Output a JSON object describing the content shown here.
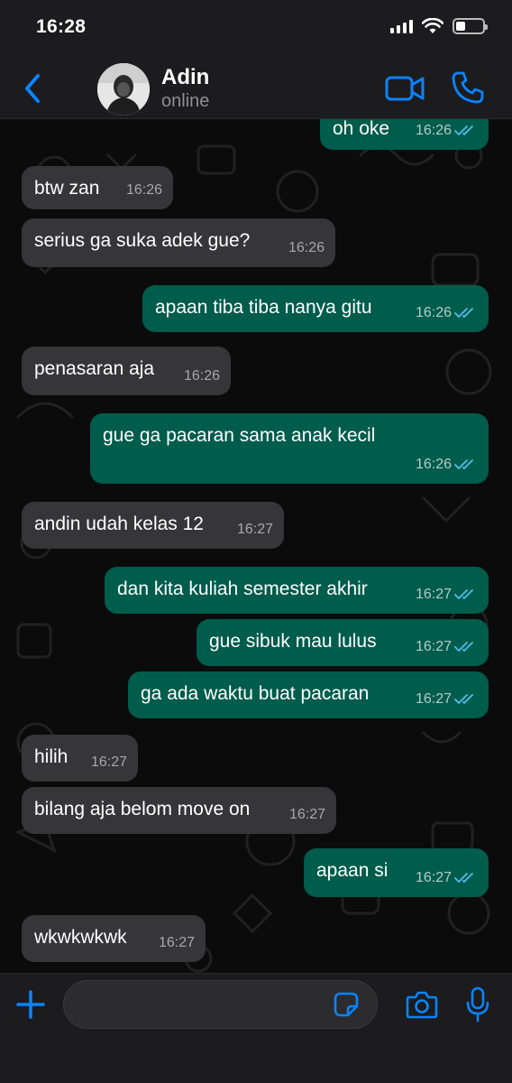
{
  "status_bar": {
    "time": "16:28",
    "battery_level": 0.35
  },
  "header": {
    "contact_name": "Adin",
    "contact_status": "online"
  },
  "icons": {
    "back": "chevron-left-icon",
    "video": "video-camera-icon",
    "call": "phone-icon",
    "add": "plus-icon",
    "sticker": "sticker-icon",
    "camera": "camera-icon",
    "mic": "microphone-icon"
  },
  "colors": {
    "accent": "#0a84ff",
    "incoming_bubble": "#363638",
    "outgoing_bubble": "#005c4b",
    "read_ticks": "#53bdeb"
  },
  "messages": [
    {
      "dir": "out",
      "text": "oh oke",
      "time": "16:26",
      "read": true
    },
    {
      "dir": "in",
      "text": "btw zan",
      "time": "16:26"
    },
    {
      "dir": "in",
      "text": "serius ga suka adek gue?",
      "time": "16:26"
    },
    {
      "dir": "out",
      "text": "apaan tiba tiba nanya gitu",
      "time": "16:26",
      "read": true
    },
    {
      "dir": "in",
      "text": "penasaran aja",
      "time": "16:26"
    },
    {
      "dir": "out",
      "text": "gue ga pacaran sama anak kecil",
      "time": "16:26",
      "read": true
    },
    {
      "dir": "in",
      "text": "andin udah kelas 12",
      "time": "16:27"
    },
    {
      "dir": "out",
      "text": "dan kita kuliah semester akhir",
      "time": "16:27",
      "read": true
    },
    {
      "dir": "out",
      "text": "gue sibuk mau lulus",
      "time": "16:27",
      "read": true
    },
    {
      "dir": "out",
      "text": "ga ada waktu buat pacaran",
      "time": "16:27",
      "read": true
    },
    {
      "dir": "in",
      "text": "hilih",
      "time": "16:27"
    },
    {
      "dir": "in",
      "text": "bilang aja belom move on",
      "time": "16:27"
    },
    {
      "dir": "out",
      "text": "apaan si",
      "time": "16:27",
      "read": true
    },
    {
      "dir": "in",
      "text": "wkwkwkwk",
      "time": "16:27"
    }
  ],
  "composer": {
    "value": "",
    "placeholder": ""
  }
}
